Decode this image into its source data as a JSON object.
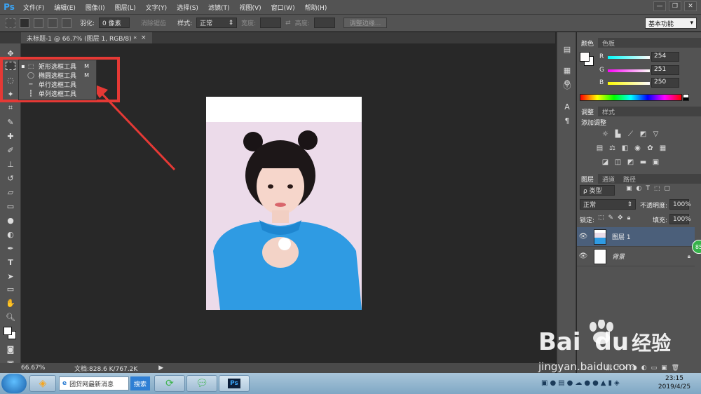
{
  "app": {
    "logo": "Ps",
    "accent": "#3aa3f3"
  },
  "menu": [
    "文件(F)",
    "编辑(E)",
    "图像(I)",
    "图层(L)",
    "文字(Y)",
    "选择(S)",
    "滤镜(T)",
    "视图(V)",
    "窗口(W)",
    "帮助(H)"
  ],
  "window_controls": {
    "minimize": "—",
    "restore": "❐",
    "close": "✕"
  },
  "options": {
    "feather_label": "羽化:",
    "feather_value": "0 像素",
    "antialias_label": "消除锯齿",
    "style_label": "样式:",
    "style_value": "正常",
    "width_label": "宽度:",
    "height_label": "高度:",
    "refine_edge": "调整边缘...",
    "workspace": "基本功能"
  },
  "document": {
    "tab_title": "未标题-1 @ 66.7% (图层 1, RGB/8) *",
    "close": "×"
  },
  "status": {
    "zoom": "66.67%",
    "doc_info": "文档:828.6 K/767.2K"
  },
  "tool_popup": [
    {
      "label": "矩形选框工具",
      "key": "M",
      "icon": "rect-marquee-icon",
      "active": true
    },
    {
      "label": "椭圆选框工具",
      "key": "M",
      "icon": "ellipse-marquee-icon",
      "active": false
    },
    {
      "label": "单行选框工具",
      "key": "",
      "icon": "single-row-marquee-icon",
      "active": false
    },
    {
      "label": "单列选框工具",
      "key": "",
      "icon": "single-column-marquee-icon",
      "active": false
    }
  ],
  "color_panel": {
    "tabs": [
      "颜色",
      "色板"
    ],
    "r_label": "R",
    "r_value": "254",
    "g_label": "G",
    "g_value": "251",
    "b_label": "B",
    "b_value": "250"
  },
  "adjust_panel": {
    "tabs": [
      "调整",
      "样式"
    ],
    "title": "添加调整"
  },
  "layers_panel": {
    "tabs": [
      "图层",
      "通道",
      "路径"
    ],
    "filter_label": "ρ 类型",
    "blend_mode": "正常",
    "opacity_label": "不透明度:",
    "opacity_value": "100%",
    "lock_label": "锁定:",
    "fill_label": "填充:",
    "fill_value": "100%",
    "layers": [
      {
        "name": "图层 1",
        "selected": true
      },
      {
        "name": "背景",
        "selected": false
      }
    ],
    "badge": "85"
  },
  "taskbar": {
    "search_text": "团贷网最新消息",
    "search_button": "搜索",
    "time": "23:15",
    "date": "2019/4/25"
  },
  "watermark": {
    "brand": "Bai",
    "brand2": "du",
    "brand3": "经验",
    "url": "jingyan.baidu.com"
  }
}
